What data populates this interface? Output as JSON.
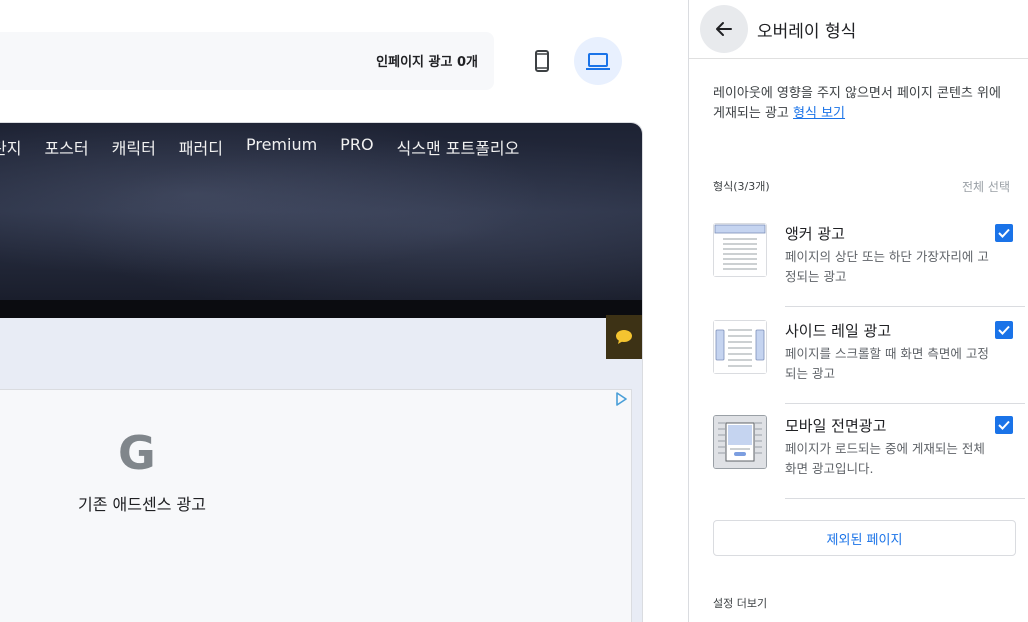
{
  "toolbar": {
    "inpage_ads_count": "인페이지 광고 0개",
    "device_mobile_icon": "smartphone-icon",
    "device_desktop_icon": "laptop-icon"
  },
  "preview": {
    "nav_items": [
      "탄지",
      "포스터",
      "캐릭터",
      "패러디",
      "Premium",
      "PRO",
      "식스맨 포트폴리오"
    ],
    "ad_logo": "G",
    "ad_label": "기존 애드센스 광고"
  },
  "panel": {
    "title": "오버레이 형식",
    "description": "레이아웃에 영향을 주지 않으면서 페이지 콘텐츠 위에 게재되는 광고",
    "description_link": "형식 보기",
    "formats_label": "형식(3/3개)",
    "select_all": "전체 선택",
    "formats": [
      {
        "name": "앵커 광고",
        "desc": "페이지의 상단 또는 하단 가장자리에 고정되는 광고",
        "checked": true
      },
      {
        "name": "사이드 레일 광고",
        "desc": "페이지를 스크롤할 때 화면 측면에 고정되는 광고",
        "checked": true
      },
      {
        "name": "모바일 전면광고",
        "desc": "페이지가 로드되는 중에 게재되는 전체 화면 광고입니다.",
        "checked": true
      }
    ],
    "excluded_pages_button": "제외된 페이지",
    "more_settings": "설정 더보기"
  },
  "colors": {
    "accent": "#1a73e8",
    "selected_device_bg": "#e8f0fe"
  }
}
